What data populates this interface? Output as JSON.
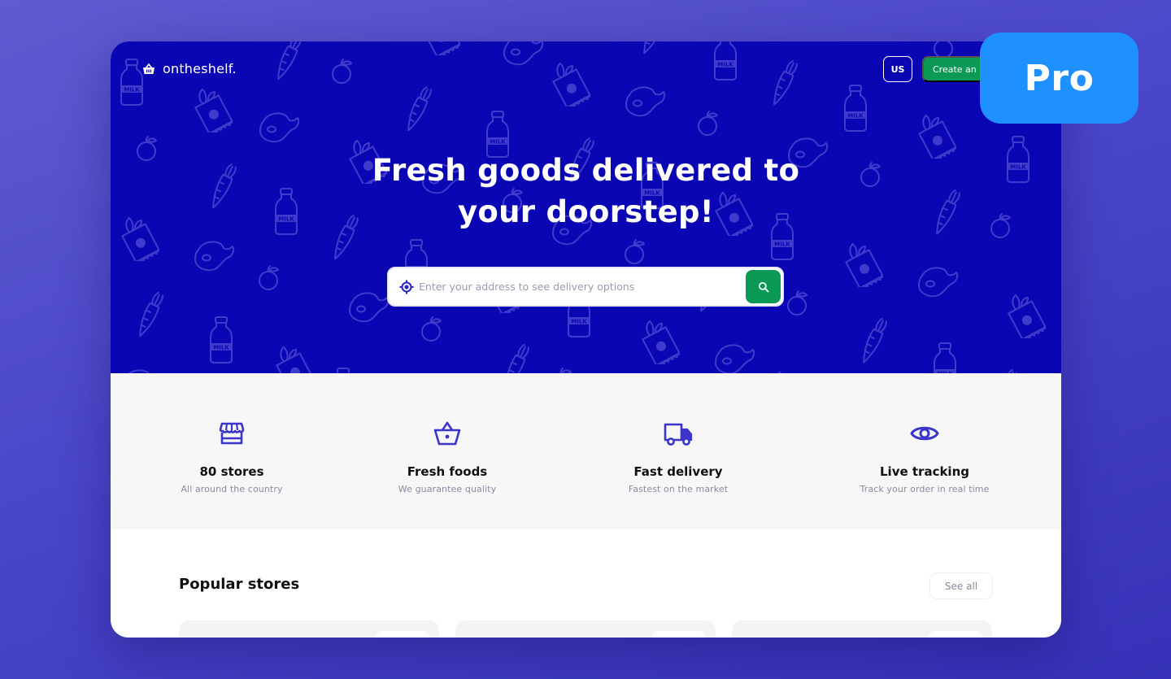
{
  "header": {
    "logo_icon": "basket-icon",
    "brand": "ontheshelf.",
    "language": "US",
    "create_account_label": "Create an account"
  },
  "hero": {
    "title_line1": "Fresh goods delivered to",
    "title_line2": "your doorstep!",
    "search": {
      "location_icon": "location-crosshair-icon",
      "placeholder": "Enter your address to see delivery options",
      "value": "",
      "button_icon": "search-icon"
    },
    "pattern_icons": [
      "steak-icon",
      "milk-bottle-icon",
      "peach-icon",
      "snack-bag-icon",
      "carrot-icon"
    ],
    "pattern_text": "MILK"
  },
  "features": [
    {
      "icon": "store-icon",
      "title": "80 stores",
      "subtitle": "All around the country"
    },
    {
      "icon": "basket-icon",
      "title": "Fresh foods",
      "subtitle": "We guarantee quality"
    },
    {
      "icon": "truck-icon",
      "title": "Fast delivery",
      "subtitle": "Fastest on the market"
    },
    {
      "icon": "eye-icon",
      "title": "Live tracking",
      "subtitle": "Track your order in real time"
    }
  ],
  "popular": {
    "title": "Popular stores",
    "see_all_label": "See all",
    "store_cards": [
      {},
      {},
      {}
    ]
  },
  "badge": {
    "label": "Pro"
  },
  "colors": {
    "hero_bg": "#0a06b3",
    "accent_green": "#0b9a55",
    "icon_purple": "#3b35c9",
    "pro_blue": "#1e90ff"
  }
}
